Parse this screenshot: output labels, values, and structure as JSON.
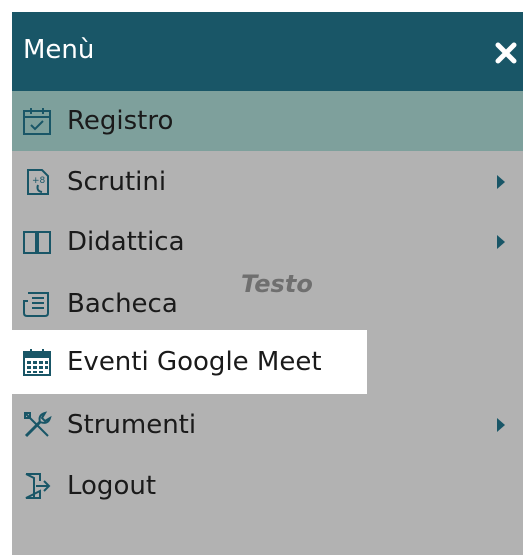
{
  "menu": {
    "title": "Menù",
    "items": [
      {
        "label": "Registro",
        "icon": "calendar-check-icon",
        "active": true,
        "submenu": false
      },
      {
        "label": "Scrutini",
        "icon": "grade-document-icon",
        "active": false,
        "submenu": true
      },
      {
        "label": "Didattica",
        "icon": "book-icon",
        "active": false,
        "submenu": true
      },
      {
        "label": "Bacheca",
        "icon": "newspaper-icon",
        "active": false,
        "submenu": false
      },
      {
        "label": "Eventi Google Meet",
        "icon": "calendar-icon",
        "active": false,
        "submenu": false,
        "highlighted": true
      },
      {
        "label": "Strumenti",
        "icon": "tools-icon",
        "active": false,
        "submenu": true
      },
      {
        "label": "Logout",
        "icon": "logout-icon",
        "active": false,
        "submenu": false
      }
    ]
  },
  "overlay": {
    "text": "Testo"
  },
  "colors": {
    "header": "#195667",
    "menu_background": "#b2b2b2",
    "active_item": "#7ea09c",
    "highlight": "#ffffff",
    "accent": "#195667"
  }
}
